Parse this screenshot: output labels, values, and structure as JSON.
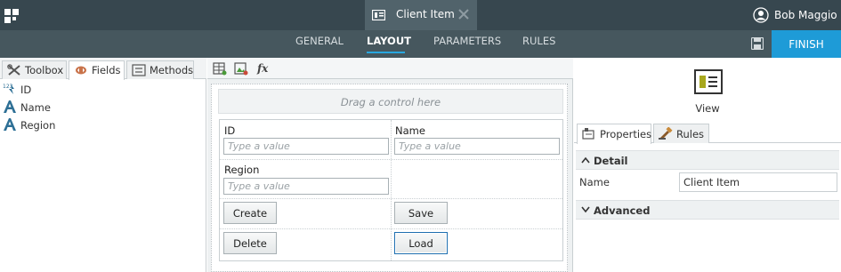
{
  "header": {
    "document_tab": {
      "title": "Client Item"
    },
    "user": {
      "name": "Bob Maggio"
    }
  },
  "nav": {
    "tabs": [
      {
        "label": "GENERAL"
      },
      {
        "label": "LAYOUT"
      },
      {
        "label": "PARAMETERS"
      },
      {
        "label": "RULES"
      }
    ],
    "active_tab": "LAYOUT",
    "finish_label": "FINISH"
  },
  "left_panel": {
    "tabs": [
      {
        "label": "Toolbox"
      },
      {
        "label": "Fields"
      },
      {
        "label": "Methods"
      }
    ],
    "active_tab": "Fields",
    "fields": [
      {
        "label": "ID",
        "icon": "autonumber-field-icon"
      },
      {
        "label": "Name",
        "icon": "text-field-icon"
      },
      {
        "label": "Region",
        "icon": "text-field-icon"
      }
    ]
  },
  "canvas": {
    "drop_hint": "Drag a control here",
    "fields": {
      "id_label": "ID",
      "id_placeholder": "Type a value",
      "name_label": "Name",
      "name_placeholder": "Type a value",
      "region_label": "Region",
      "region_placeholder": "Type a value"
    },
    "buttons": {
      "create": "Create",
      "save": "Save",
      "delete": "Delete",
      "load": "Load"
    }
  },
  "right_panel": {
    "view_label": "View",
    "tabs": [
      {
        "label": "Properties"
      },
      {
        "label": "Rules"
      }
    ],
    "active_tab": "Properties",
    "detail_section": "Detail",
    "name_label": "Name",
    "name_value": "Client Item",
    "advanced_section": "Advanced"
  },
  "colors": {
    "topbar": "#37474f",
    "navbar": "#46575e",
    "accent": "#1e9bd7"
  }
}
